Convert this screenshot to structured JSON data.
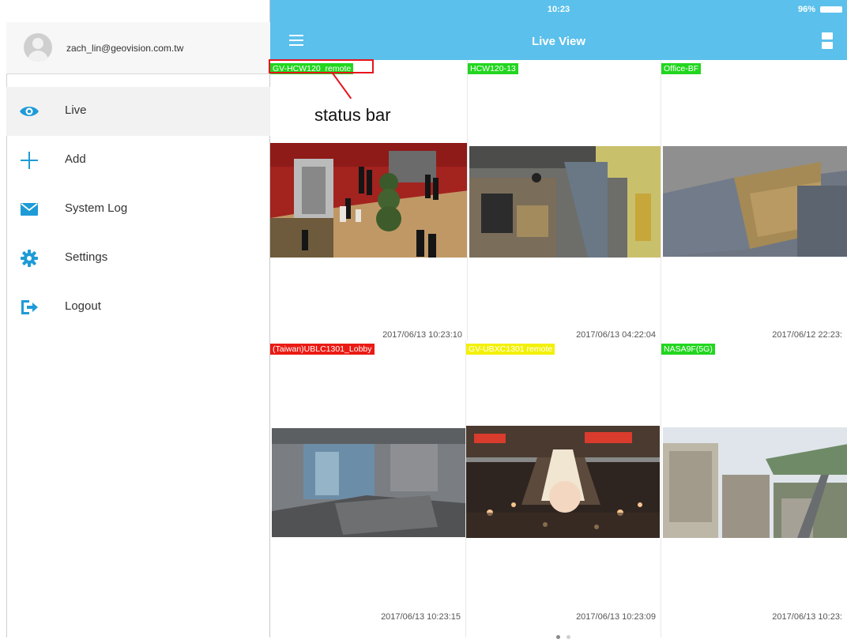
{
  "status_bar": {
    "time": "10:23",
    "battery": "96%"
  },
  "nav_bar": {
    "title": "Live View"
  },
  "sidebar": {
    "user_email": "zach_lin@geovision.com.tw",
    "items": [
      {
        "label": "Live",
        "icon": "eye-icon"
      },
      {
        "label": "Add",
        "icon": "plus-icon"
      },
      {
        "label": "System Log",
        "icon": "envelope-icon"
      },
      {
        "label": "Settings",
        "icon": "gear-icon"
      },
      {
        "label": "Logout",
        "icon": "logout-icon"
      }
    ]
  },
  "cameras": [
    {
      "name": "GV-HCW120_remote",
      "status_color": "#22d61f",
      "time": "2017/06/13 10:23:10"
    },
    {
      "name": "HCW120-13",
      "status_color": "#22d61f",
      "time": "2017/06/13 04:22:04"
    },
    {
      "name": "Office-BF",
      "status_color": "#22d61f",
      "time": "2017/06/12 22:23:"
    },
    {
      "name": "(Taiwan)UBLC1301_Lobby",
      "status_color": "#ea1b14",
      "time": "2017/06/13 10:23:15"
    },
    {
      "name": "GV-UBXC1301 remote",
      "status_color": "#f3f007",
      "time": "2017/06/13 10:23:09"
    },
    {
      "name": "NASA9F(5G)",
      "status_color": "#22d61f",
      "time": "2017/06/13 10:23:"
    }
  ],
  "annotation": {
    "label": "status bar",
    "color": "#e8141c"
  },
  "theme": {
    "accent": "#5bc0eb"
  },
  "page_dots": {
    "active": 0,
    "count": 2
  }
}
